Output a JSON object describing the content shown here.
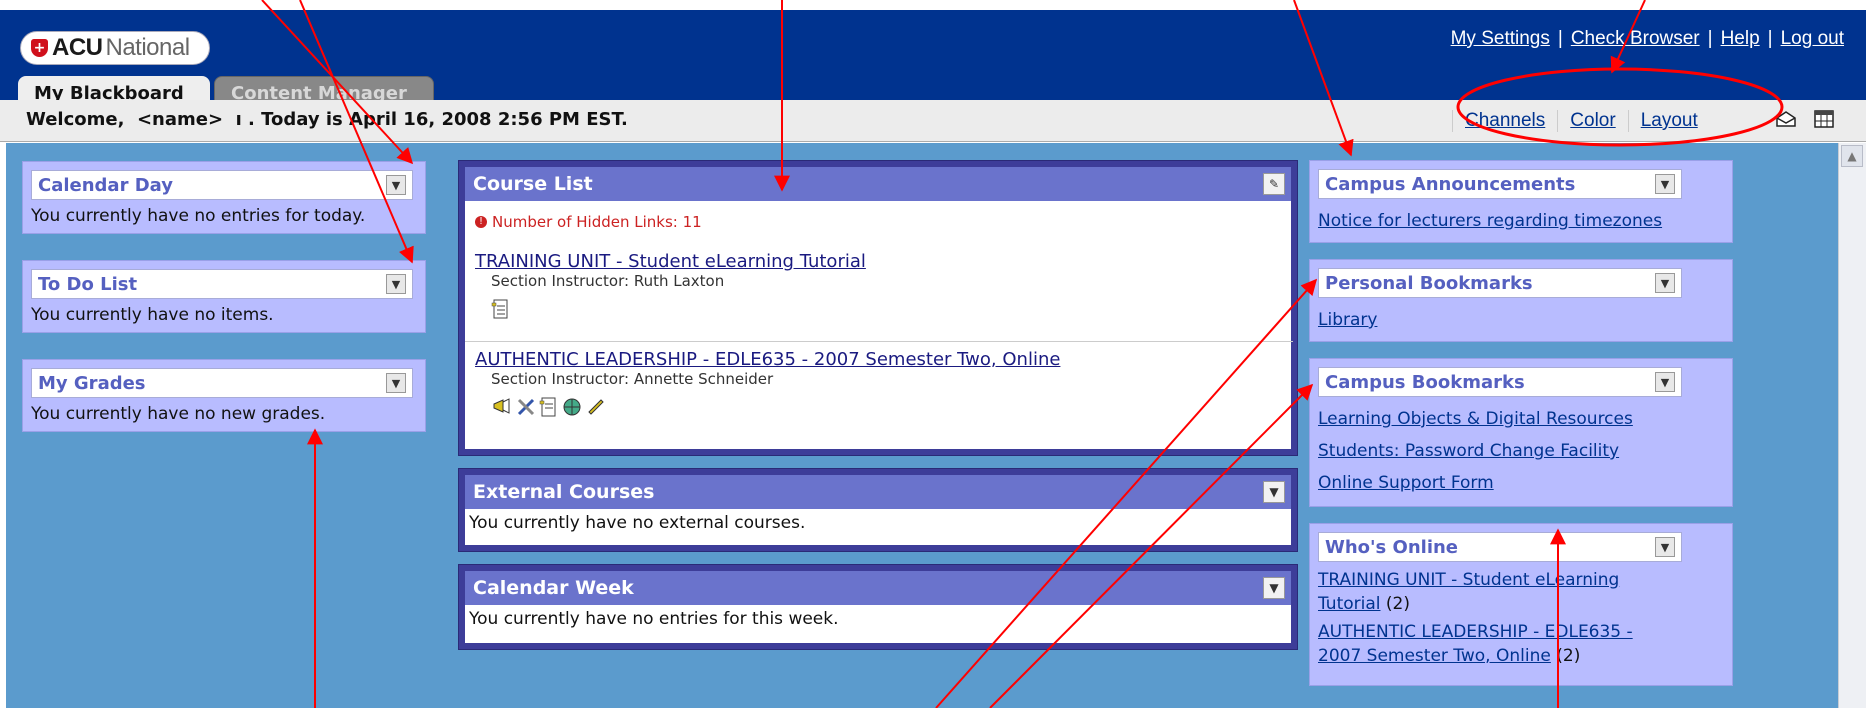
{
  "logo": {
    "brand": "ACU",
    "suffix": "National",
    "shield_glyph": "+"
  },
  "top_links": [
    "My Settings",
    "Check Browser",
    "Help",
    "Log out"
  ],
  "tabs": {
    "active": "My Blackboard",
    "inactive": "Content Manager"
  },
  "welcome": {
    "text": "Welcome,  <name>  ı . Today is April 16, 2008 2:56 PM EST."
  },
  "layout_links": [
    "Channels",
    "Color",
    "Layout"
  ],
  "header_icons": [
    "envelope-icon",
    "calendar-icon"
  ],
  "left_column": {
    "calendar_day": {
      "title": "Calendar Day",
      "body": "You currently have no entries for today."
    },
    "todo": {
      "title": "To Do List",
      "body": "You currently have no items."
    },
    "grades": {
      "title": "My Grades",
      "body": "You currently have no new grades."
    }
  },
  "course_list": {
    "title": "Course List",
    "hidden_links": "Number of Hidden Links: 11",
    "courses": [
      {
        "name": "TRAINING UNIT - Student eLearning Tutorial",
        "instructor": "Section Instructor: Ruth Laxton"
      },
      {
        "name": "AUTHENTIC LEADERSHIP - EDLE635 - 2007 Semester Two, Online",
        "instructor": "Section Instructor: Annette Schneider"
      }
    ]
  },
  "external_courses": {
    "title": "External Courses",
    "body": "You currently have no external courses."
  },
  "calendar_week": {
    "title": "Calendar Week",
    "body": "You currently have no entries for this week."
  },
  "right_column": {
    "announcements": {
      "title": "Campus Announcements",
      "links": [
        "Notice for lecturers regarding timezones"
      ]
    },
    "personal_bookmarks": {
      "title": "Personal Bookmarks",
      "links": [
        "Library"
      ]
    },
    "campus_bookmarks": {
      "title": "Campus Bookmarks",
      "links": [
        "Learning Objects & Digital Resources",
        "Students: Password Change Facility",
        "Online Support Form"
      ]
    },
    "whos_online": {
      "title": "Who's Online",
      "entries": [
        {
          "line1": "TRAINING UNIT - Student eLearning",
          "line2": "Tutorial",
          "count": "(2)"
        },
        {
          "line1": "AUTHENTIC LEADERSHIP - EDLE635 -",
          "line2": "2007 Semester Two, Online",
          "count": "(2)"
        }
      ]
    }
  },
  "colors": {
    "topbar": "#00338f",
    "content_bg": "#5b9bcd",
    "annotation": "#ff0000"
  }
}
